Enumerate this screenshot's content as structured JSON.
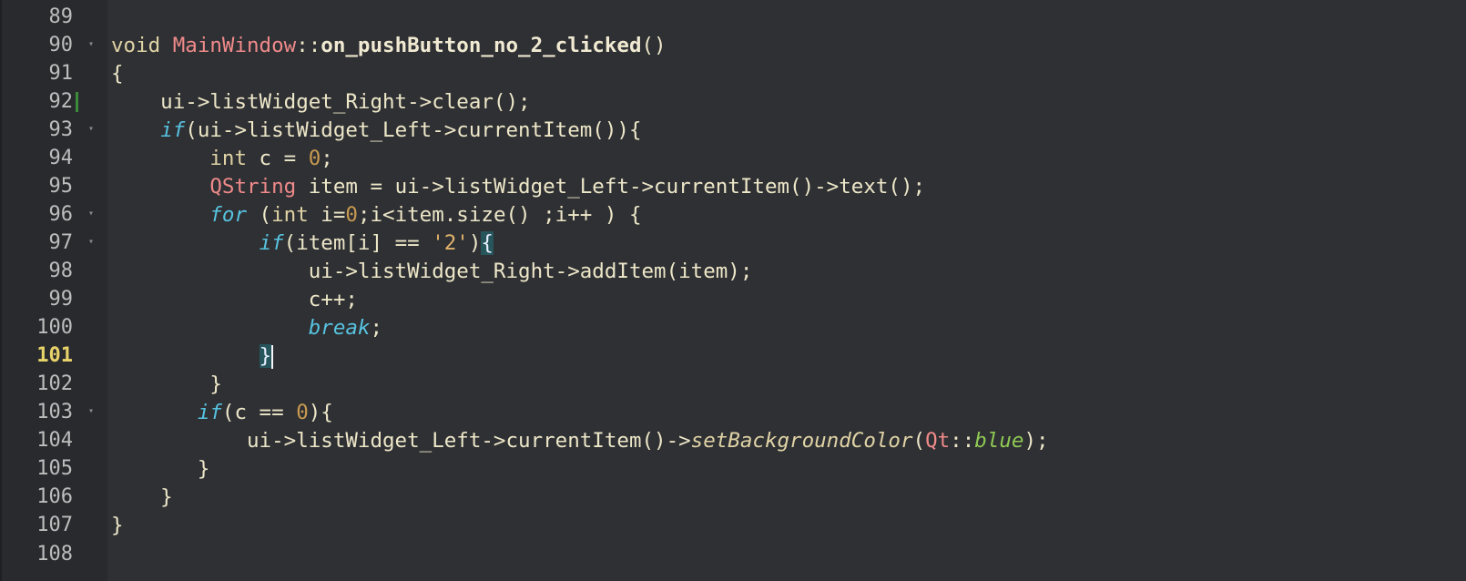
{
  "editor": {
    "current_line": "101",
    "lines": [
      {
        "num": "89",
        "code": [
          ""
        ]
      },
      {
        "num": "90",
        "code": [
          "void",
          " ",
          "MainWindow",
          "::",
          "on_pushButton_no_2_clicked",
          "()"
        ]
      },
      {
        "num": "91",
        "code": [
          "{"
        ]
      },
      {
        "num": "92",
        "code": [
          "    ui->listWidget_Right->clear();"
        ]
      },
      {
        "num": "93",
        "code": [
          "    ",
          "if",
          "(ui->listWidget_Left->currentItem()){"
        ]
      },
      {
        "num": "94",
        "code": [
          "        ",
          "int",
          " c = ",
          "0",
          ";"
        ]
      },
      {
        "num": "95",
        "code": [
          "        ",
          "QString",
          " item = ui->listWidget_Left->currentItem()->text();"
        ]
      },
      {
        "num": "96",
        "code": [
          "        ",
          "for",
          " (",
          "int",
          " i=",
          "0",
          ";i<item.size() ;i++ ) {"
        ]
      },
      {
        "num": "97",
        "code": [
          "            ",
          "if",
          "(item[i] == ",
          "'2'",
          ")",
          "{"
        ]
      },
      {
        "num": "98",
        "code": [
          "                ui->listWidget_Right->addItem(item);"
        ]
      },
      {
        "num": "99",
        "code": [
          "                c++;"
        ]
      },
      {
        "num": "100",
        "code": [
          "                ",
          "break",
          ";"
        ]
      },
      {
        "num": "101",
        "code": [
          "            ",
          "}"
        ]
      },
      {
        "num": "102",
        "code": [
          "        }"
        ]
      },
      {
        "num": "103",
        "code": [
          "       ",
          "if",
          "(c == ",
          "0",
          "){"
        ]
      },
      {
        "num": "104",
        "code": [
          "           ui->listWidget_Left->currentItem()->",
          "setBackgroundColor",
          "(",
          "Qt",
          "::",
          "blue",
          ");"
        ]
      },
      {
        "num": "105",
        "code": [
          "       }"
        ]
      },
      {
        "num": "106",
        "code": [
          "    }"
        ]
      },
      {
        "num": "107",
        "code": [
          "}"
        ]
      },
      {
        "num": "108",
        "code": [
          ""
        ]
      }
    ]
  },
  "colors": {
    "background": "#2f3034",
    "gutter": "#292a2e",
    "keyword_type": "#f08a8a",
    "keyword_flow": "#57c3e0",
    "number": "#c89a50",
    "current_line_number": "#e8d36a",
    "bracket_highlight": "#26555c"
  }
}
